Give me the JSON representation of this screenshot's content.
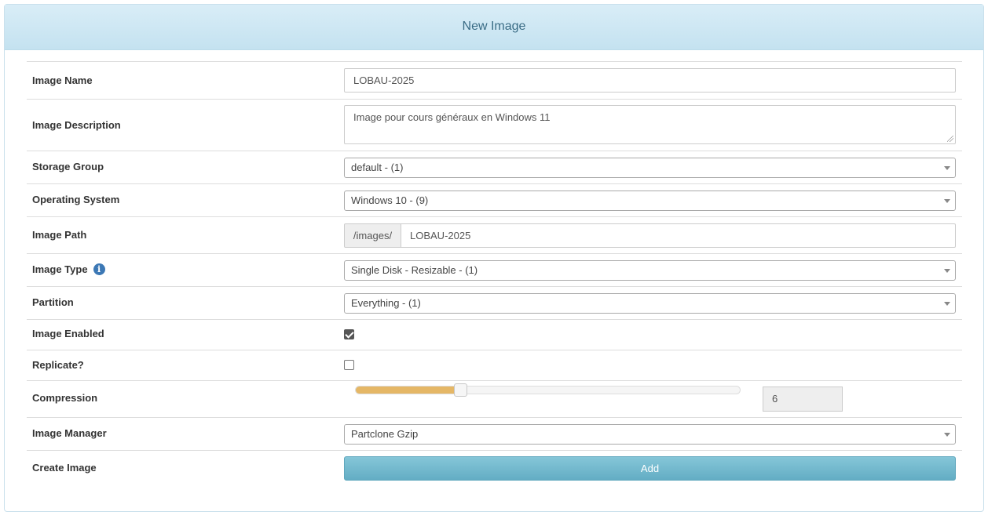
{
  "panel": {
    "title": "New Image"
  },
  "fields": {
    "image_name": {
      "label": "Image Name",
      "value": "LOBAU-2025"
    },
    "image_description": {
      "label": "Image Description",
      "value": "Image pour cours généraux en Windows 11"
    },
    "storage_group": {
      "label": "Storage Group",
      "selected": "default - (1)"
    },
    "operating_system": {
      "label": "Operating System",
      "selected": "Windows 10 - (9)"
    },
    "image_path": {
      "label": "Image Path",
      "prefix": "/images/",
      "value": "LOBAU-2025"
    },
    "image_type": {
      "label": "Image Type",
      "info_icon": "info-icon",
      "selected": "Single Disk - Resizable - (1)"
    },
    "partition": {
      "label": "Partition",
      "selected": "Everything - (1)"
    },
    "image_enabled": {
      "label": "Image Enabled",
      "checked": true
    },
    "replicate": {
      "label": "Replicate?",
      "checked": false
    },
    "compression": {
      "label": "Compression",
      "value": "6",
      "min": 0,
      "max": 22
    },
    "image_manager": {
      "label": "Image Manager",
      "selected": "Partclone Gzip"
    },
    "create_image": {
      "label": "Create Image",
      "button_label": "Add"
    }
  },
  "colors": {
    "heading_bg": "#d9edf7",
    "heading_text": "#3a6c85",
    "slider_fill": "#e5b766",
    "button_bg": "#6fb8cd",
    "info_icon": "#3c78b5"
  }
}
